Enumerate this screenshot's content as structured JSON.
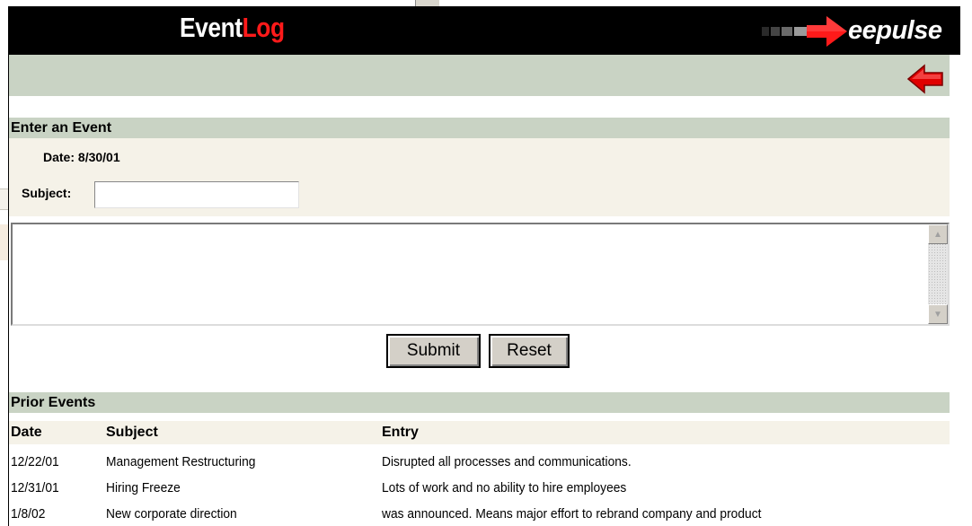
{
  "app": {
    "logo_prefix": "Event",
    "logo_accent": "Log",
    "brand": "eepulse",
    "accent_color": "#ff1a1a",
    "nav_color": "#c9d3c4",
    "form_bg_color": "#f5f2e8"
  },
  "nav": {
    "back_icon": "red-left-arrow-icon"
  },
  "form": {
    "section_title": "Enter an Event",
    "date_label": "Date:",
    "date_value": "8/30/01",
    "subject_label": "Subject:",
    "subject_value": "",
    "entry_value": "",
    "submit_label": "Submit",
    "reset_label": "Reset"
  },
  "prior": {
    "section_title": "Prior Events",
    "columns": [
      "Date",
      "Subject",
      "Entry"
    ],
    "rows": [
      {
        "date": "12/22/01",
        "subject": "Management Restructuring",
        "entry": "Disrupted all processes and communications."
      },
      {
        "date": "12/31/01",
        "subject": "Hiring Freeze",
        "entry": "Lots of work and no ability to hire employees"
      },
      {
        "date": "1/8/02",
        "subject": "New corporate direction",
        "entry": "was announced.  Means major effort to rebrand company and product"
      }
    ]
  }
}
